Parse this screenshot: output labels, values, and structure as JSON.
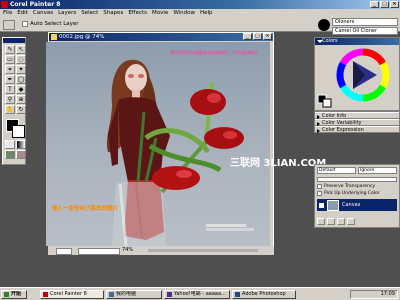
{
  "window": {
    "title": "Corel Painter 8"
  },
  "menu": [
    "File",
    "Edit",
    "Canvas",
    "Layers",
    "Select",
    "Shapes",
    "Effects",
    "Movie",
    "Window",
    "Help"
  ],
  "propbar": {
    "auto_select_label": "Auto Select Layer"
  },
  "brush": {
    "category": "Oloners",
    "variant": "Camel Oil Cloner"
  },
  "document": {
    "title": "0002.jpg @ 74%",
    "zoom": "74%"
  },
  "image_text": {
    "photo_caption": "照片效果作为克隆源(直接被着色，不受油彩属性)",
    "note": "输入一张你自己喜欢的图片",
    "watermark": "三联网 3LIAN.COM"
  },
  "panels": {
    "colors_title": "Colors",
    "color_info": "Color Info",
    "color_variability": "Color Variability",
    "color_expression": "Color Expression",
    "layers_composite": "Default",
    "layers_mode": "Ignore",
    "preserve_transparency": "Preserve Transparency",
    "pick_up_color": "Pick Up Underlying Color",
    "canvas_layer": "Canvas"
  },
  "taskbar": {
    "start_label": "开始",
    "items": [
      "Corel Painter 8",
      "我的电脑",
      "Yahoo!电邮 - aaaaa...",
      "Adobe Photoshop"
    ],
    "clock": "17:09"
  },
  "colors": {
    "accent": "#0a246a",
    "face": "#d4d0c8",
    "workspace": "#4f4f4f",
    "dress": "#8b1a1a",
    "flower": "#b31212"
  }
}
